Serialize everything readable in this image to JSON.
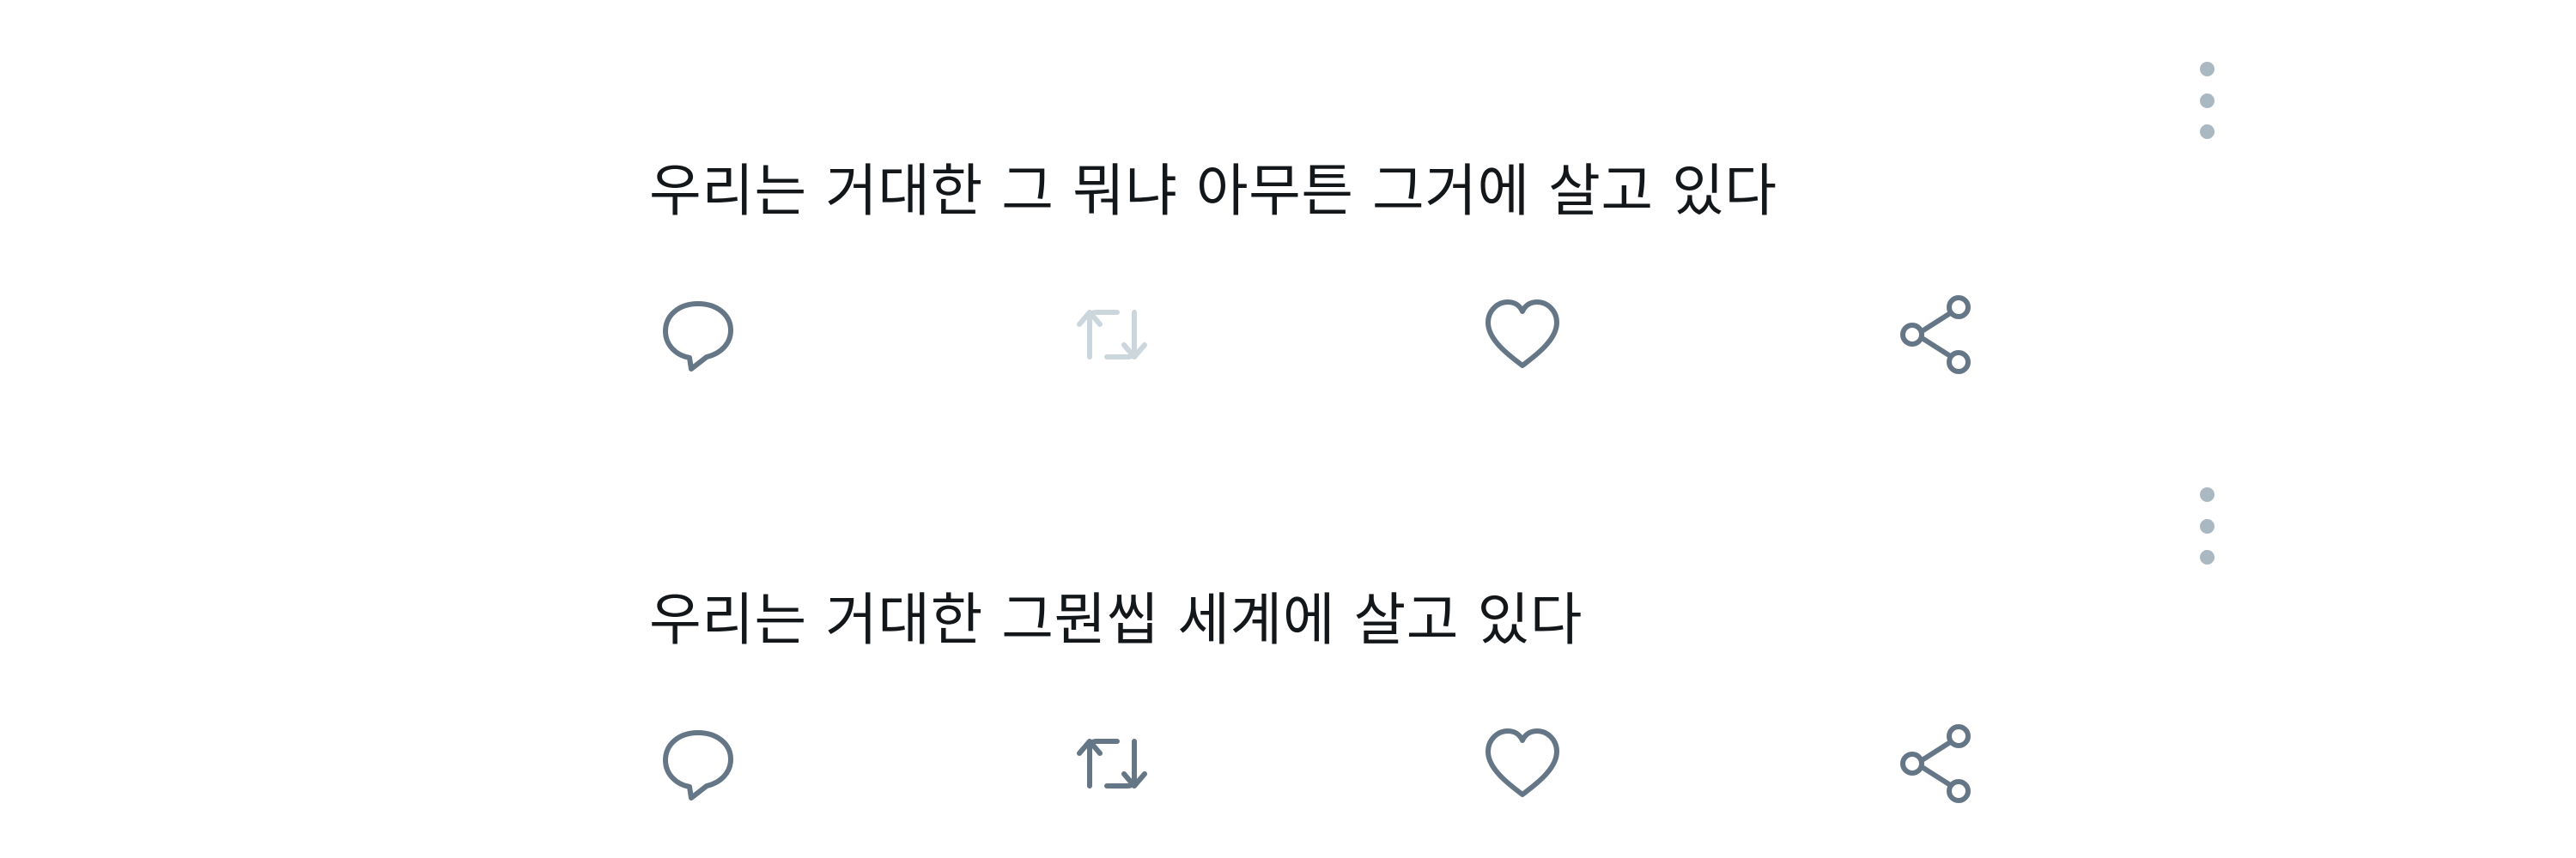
{
  "tweets": [
    {
      "text": "우리는 거대한 그 뭐냐 아무튼 그거에 살고 있다",
      "retweet_enabled": false,
      "icon_colors": {
        "reply": "#657786",
        "retweet": "#ccd6dd",
        "like": "#657786",
        "share": "#657786"
      }
    },
    {
      "text": "우리는 거대한 그뭔씹 세계에 살고 있다",
      "retweet_enabled": true,
      "icon_colors": {
        "reply": "#657786",
        "retweet": "#657786",
        "like": "#657786",
        "share": "#657786"
      }
    }
  ],
  "icons": {
    "more": "vertical-ellipsis-icon",
    "reply": "speech-bubble-icon",
    "retweet": "retweet-arrows-icon",
    "like": "heart-outline-icon",
    "share": "share-nodes-icon"
  },
  "colors": {
    "text": "#14171a",
    "icon": "#657786",
    "icon_disabled": "#ccd6dd",
    "more_dots": "#aab8c2"
  }
}
